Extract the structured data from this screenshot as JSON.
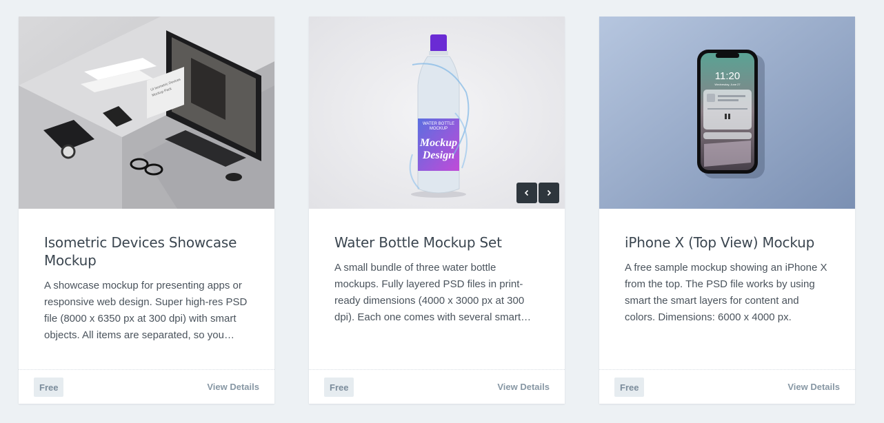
{
  "cards": [
    {
      "title": "Isometric Devices Showcase Mockup",
      "description": "A showcase mockup for presenting apps or responsive web design. Super high-res PSD file (8000 x 6350 px at 300 dpi) with smart objects. All items are separated, so you…",
      "badge": "Free",
      "link": "View Details",
      "image_text": [
        "UI Isometric Devices",
        "Mockup Pack"
      ]
    },
    {
      "title": "Water Bottle Mockup Set",
      "description": "A small bundle of three water bottle mockups. Fully layered PSD files in print-ready dimensions (4000 x 3000 px at 300 dpi). Each one comes with several smart layers.",
      "badge": "Free",
      "link": "View Details",
      "image_text": [
        "WATER BOTTLE",
        "MOCKUP",
        "Mockup",
        "Design"
      ],
      "carousel": {
        "prev_icon": "chevron-left-icon",
        "next_icon": "chevron-right-icon"
      }
    },
    {
      "title": "iPhone X (Top View) Mockup",
      "description": "A free sample mockup showing an iPhone X from the top. The PSD file works by using smart the smart layers for content and colors. Dimensions: 6000 x 4000 px.",
      "badge": "Free",
      "link": "View Details",
      "image_text": [
        "11:20",
        "Wednesday, June 27"
      ]
    }
  ],
  "colors": {
    "page_bg": "#edf1f4",
    "card_bg": "#ffffff",
    "title": "#3b4650",
    "badge_bg": "#e6ecf0",
    "link": "#8797a4",
    "nav_btn": "#2e363d"
  }
}
